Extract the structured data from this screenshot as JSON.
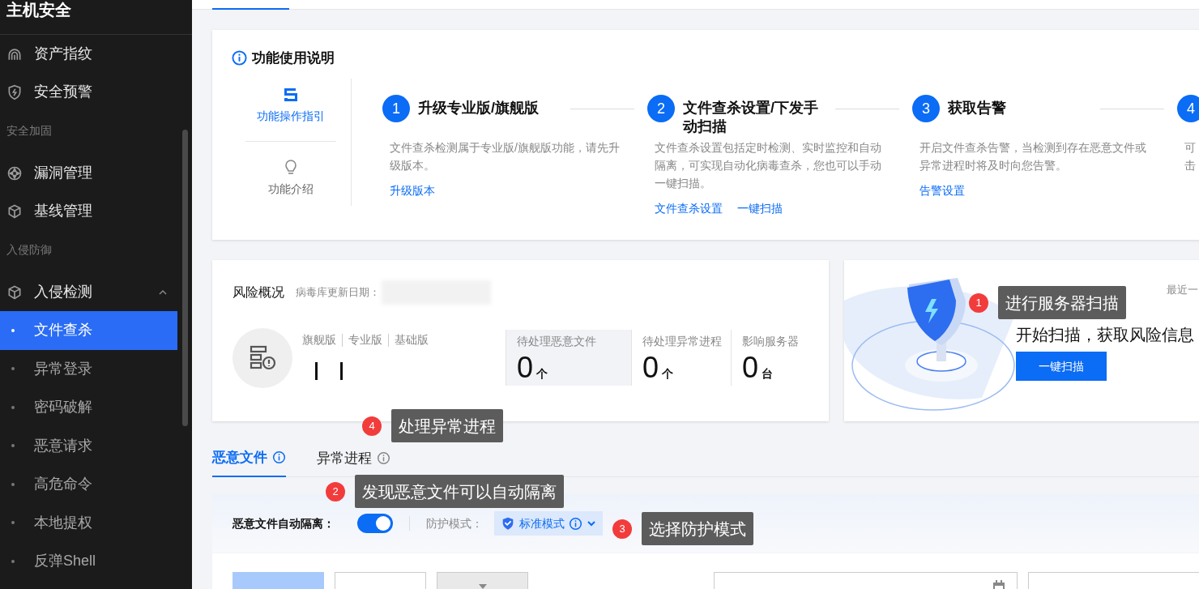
{
  "sidebar": {
    "title": "主机安全",
    "items": [
      {
        "kind": "item",
        "label": "资产指纹",
        "selected": false
      },
      {
        "kind": "item",
        "label": "安全预警",
        "selected": false
      },
      {
        "kind": "group",
        "label": "安全加固"
      },
      {
        "kind": "item",
        "label": "漏洞管理",
        "selected": false
      },
      {
        "kind": "item",
        "label": "基线管理",
        "selected": false
      },
      {
        "kind": "group",
        "label": "入侵防御"
      },
      {
        "kind": "parent",
        "label": "入侵检测",
        "expanded": true,
        "children": [
          {
            "label": "文件查杀",
            "selected": true
          },
          {
            "label": "异常登录",
            "selected": false
          },
          {
            "label": "密码破解",
            "selected": false
          },
          {
            "label": "恶意请求",
            "selected": false
          },
          {
            "label": "高危命令",
            "selected": false
          },
          {
            "label": "本地提权",
            "selected": false
          },
          {
            "label": "反弹Shell",
            "selected": false
          }
        ]
      }
    ]
  },
  "guide": {
    "title": "功能使用说明",
    "tabs": [
      {
        "label": "功能操作指引",
        "selected": true
      },
      {
        "label": "功能介绍",
        "selected": false
      }
    ],
    "steps": [
      {
        "number": "1",
        "title": "升级专业版/旗舰版",
        "description": [
          "文件查杀检测属于专业版/旗舰版功能，请先升级版本。"
        ],
        "links": [
          "升级版本"
        ]
      },
      {
        "number": "2",
        "title": "文件查杀设置/下发手动扫描",
        "description": [
          "文件查杀设置包括定时检测、实时监控和自动隔离，可实现自动化病毒查杀，您也可以手动一键扫描。"
        ],
        "links": [
          "文件查杀设置",
          "一键扫描"
        ]
      },
      {
        "number": "3",
        "title": "获取告警",
        "description": [
          "开启文件查杀告警，当检测到存在恶意文件或异常进程时将及时向您告警。"
        ],
        "links": [
          "告警设置"
        ]
      },
      {
        "number": "4",
        "description": [
          "可",
          "击"
        ]
      }
    ]
  },
  "risk": {
    "title": "风险概况",
    "update_label": "病毒库更新日期：",
    "editions": [
      "旗舰版",
      "专业版",
      "基础版"
    ],
    "stats": [
      {
        "label": "待处理恶意文件",
        "value": "0",
        "unit": "个",
        "selected": true
      },
      {
        "label": "待处理异常进程",
        "value": "0",
        "unit": "个",
        "selected": false
      },
      {
        "label": "影响服务器",
        "value": "0",
        "unit": "台",
        "selected": false
      }
    ]
  },
  "scan": {
    "recent": "最近一",
    "title": "开始扫描，获取风险信息",
    "button": "一键扫描"
  },
  "tabs": [
    {
      "label": "恶意文件",
      "selected": true
    },
    {
      "label": "异常进程",
      "selected": false
    }
  ],
  "isolation": {
    "label": "恶意文件自动隔离：",
    "on": true,
    "mode_label": "防护模式：",
    "mode_value": "标准模式"
  },
  "toolbar": {
    "buttons": [
      {
        "kind": "primary"
      },
      {
        "kind": "outline"
      },
      {
        "kind": "menu"
      }
    ]
  },
  "callouts": [
    {
      "number": "1",
      "text": "进行服务器扫描"
    },
    {
      "number": "2",
      "text": "发现恶意文件可以自动隔离"
    },
    {
      "number": "3",
      "text": "选择防护模式"
    },
    {
      "number": "4",
      "text": "处理异常进程"
    }
  ]
}
